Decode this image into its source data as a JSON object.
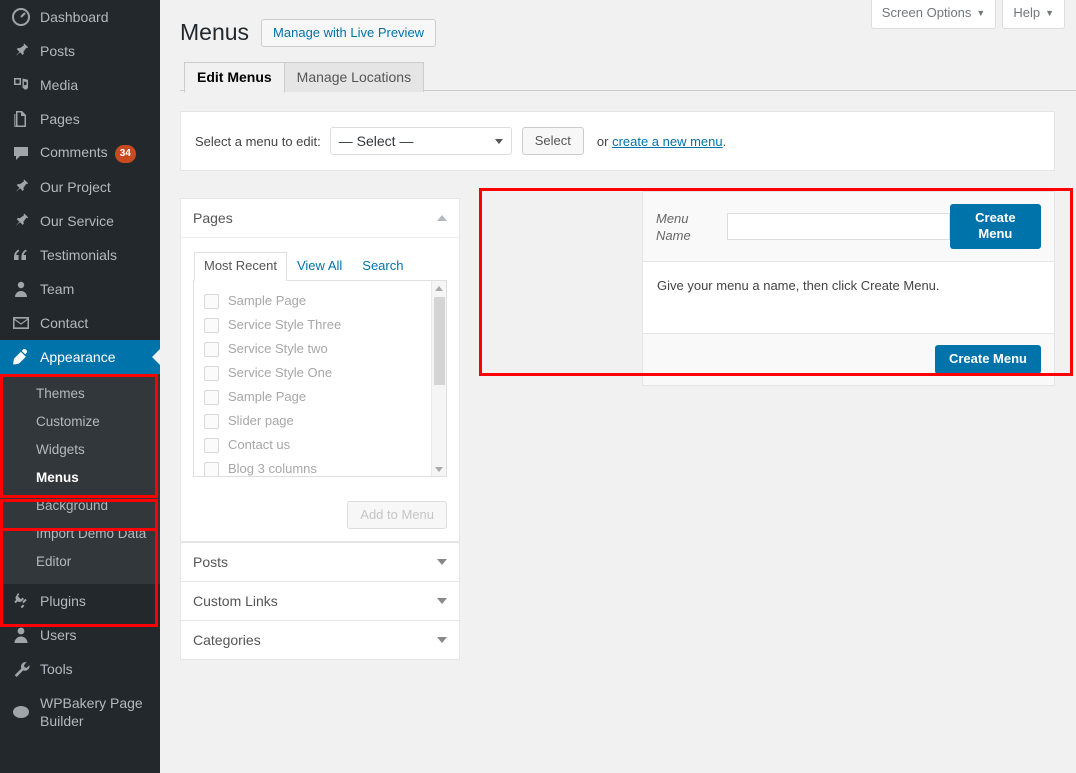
{
  "sidebar": {
    "items": [
      {
        "label": "Dashboard",
        "icon": "dashboard-icon",
        "name": "sidebar-item-dashboard"
      },
      {
        "label": "Posts",
        "icon": "pin-icon",
        "name": "sidebar-item-posts"
      },
      {
        "label": "Media",
        "icon": "media-icon",
        "name": "sidebar-item-media"
      },
      {
        "label": "Pages",
        "icon": "pages-icon",
        "name": "sidebar-item-pages"
      },
      {
        "label": "Comments",
        "icon": "comment-icon",
        "name": "sidebar-item-comments",
        "badge": "34"
      },
      {
        "label": "Our Project",
        "icon": "pin-icon",
        "name": "sidebar-item-our-project"
      },
      {
        "label": "Our Service",
        "icon": "pin-icon",
        "name": "sidebar-item-our-service"
      },
      {
        "label": "Testimonials",
        "icon": "quote-icon",
        "name": "sidebar-item-testimonials"
      },
      {
        "label": "Team",
        "icon": "user-icon",
        "name": "sidebar-item-team"
      },
      {
        "label": "Contact",
        "icon": "envelope-icon",
        "name": "sidebar-item-contact"
      }
    ],
    "appearance": {
      "label": "Appearance",
      "icon": "appearance-brush-icon",
      "submenu": [
        {
          "label": "Themes",
          "name": "submenu-item-themes",
          "current": false
        },
        {
          "label": "Customize",
          "name": "submenu-item-customize",
          "current": false
        },
        {
          "label": "Widgets",
          "name": "submenu-item-widgets",
          "current": false
        },
        {
          "label": "Menus",
          "name": "submenu-item-menus",
          "current": true
        },
        {
          "label": "Background",
          "name": "submenu-item-background",
          "current": false
        },
        {
          "label": "Import Demo Data",
          "name": "submenu-item-import-demo-data",
          "current": false
        },
        {
          "label": "Editor",
          "name": "submenu-item-editor",
          "current": false
        }
      ]
    },
    "items_bottom": [
      {
        "label": "Plugins",
        "icon": "plug-icon",
        "name": "sidebar-item-plugins"
      },
      {
        "label": "Users",
        "icon": "users-icon",
        "name": "sidebar-item-users"
      },
      {
        "label": "Tools",
        "icon": "wrench-icon",
        "name": "sidebar-item-tools"
      },
      {
        "label": "WPBakery Page Builder",
        "icon": "wpbakery-icon",
        "name": "sidebar-item-wpbakery-page-builder"
      }
    ]
  },
  "header": {
    "screen_options": "Screen Options",
    "help": "Help",
    "caret": "▼",
    "title": "Menus",
    "live_preview": "Manage with Live Preview"
  },
  "tabs": [
    {
      "label": "Edit Menus",
      "name": "tab-edit-menus",
      "active": true
    },
    {
      "label": "Manage Locations",
      "name": "tab-manage-locations",
      "active": false
    }
  ],
  "select_bar": {
    "label": "Select a menu to edit:",
    "selected": "— Select —",
    "select_button": "Select",
    "or_prefix": "or ",
    "create_link": "create a new menu",
    "or_suffix": "."
  },
  "pages_box": {
    "title": "Pages",
    "tabs": [
      {
        "label": "Most Recent",
        "name": "pages-tab-most-recent",
        "active": true
      },
      {
        "label": "View All",
        "name": "pages-tab-view-all",
        "active": false
      },
      {
        "label": "Search",
        "name": "pages-tab-search",
        "active": false
      }
    ],
    "items": [
      "Sample Page",
      "Service Style Three",
      "Service Style two",
      "Service Style One",
      "Sample Page",
      "Slider page",
      "Contact us",
      "Blog 3 columns"
    ],
    "add_button": "Add to Menu"
  },
  "collapsed_boxes": [
    {
      "title": "Posts",
      "name": "postbox-posts"
    },
    {
      "title": "Custom Links",
      "name": "postbox-custom-links"
    },
    {
      "title": "Categories",
      "name": "postbox-categories"
    }
  ],
  "menu_editor": {
    "name_label": "Menu Name",
    "name_value": "",
    "name_placeholder": "",
    "create_button_top": "Create Menu",
    "instruction": "Give your menu a name, then click Create Menu.",
    "create_button_bottom": "Create Menu"
  },
  "colors": {
    "accent_blue": "#0073aa",
    "sidebar_bg": "#23282d",
    "submenu_bg": "#32373c",
    "badge_red": "#ca4a1f",
    "annotation_red": "#ff0000",
    "page_bg": "#f1f1f1"
  }
}
